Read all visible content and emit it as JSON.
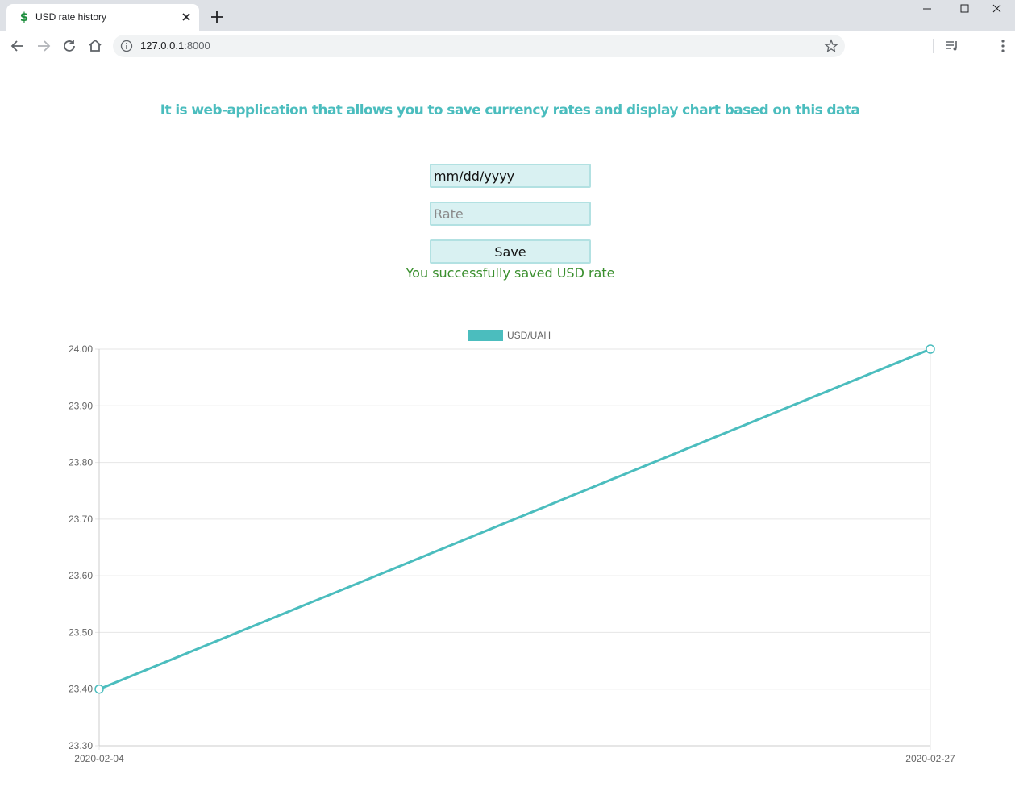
{
  "browser": {
    "tab_title": "USD rate history",
    "favicon": "$",
    "url_host": "127.0.0.1",
    "url_port": ":8000"
  },
  "page": {
    "headline": "It is web-application that allows you to save currency rates and display chart based on this data",
    "date_input": {
      "value": "mm/dd/yyyy"
    },
    "rate_input": {
      "placeholder": "Rate"
    },
    "save_label": "Save",
    "success_message": "You successfully saved USD rate"
  },
  "colors": {
    "accent": "#4bbdbe",
    "success": "#3a8f2e",
    "field_bg": "#d9f1f2"
  },
  "chart_data": {
    "type": "line",
    "title": "",
    "xlabel": "",
    "ylabel": "",
    "categories": [
      "2020-02-04",
      "2020-02-27"
    ],
    "series": [
      {
        "name": "USD/UAH",
        "values": [
          23.4,
          24.0
        ],
        "color": "#4bbdbe"
      }
    ],
    "ylim": [
      23.3,
      24.0
    ],
    "yticks": [
      "24.00",
      "23.90",
      "23.80",
      "23.70",
      "23.60",
      "23.50",
      "23.40",
      "23.30"
    ],
    "grid": true,
    "legend_position": "top"
  }
}
